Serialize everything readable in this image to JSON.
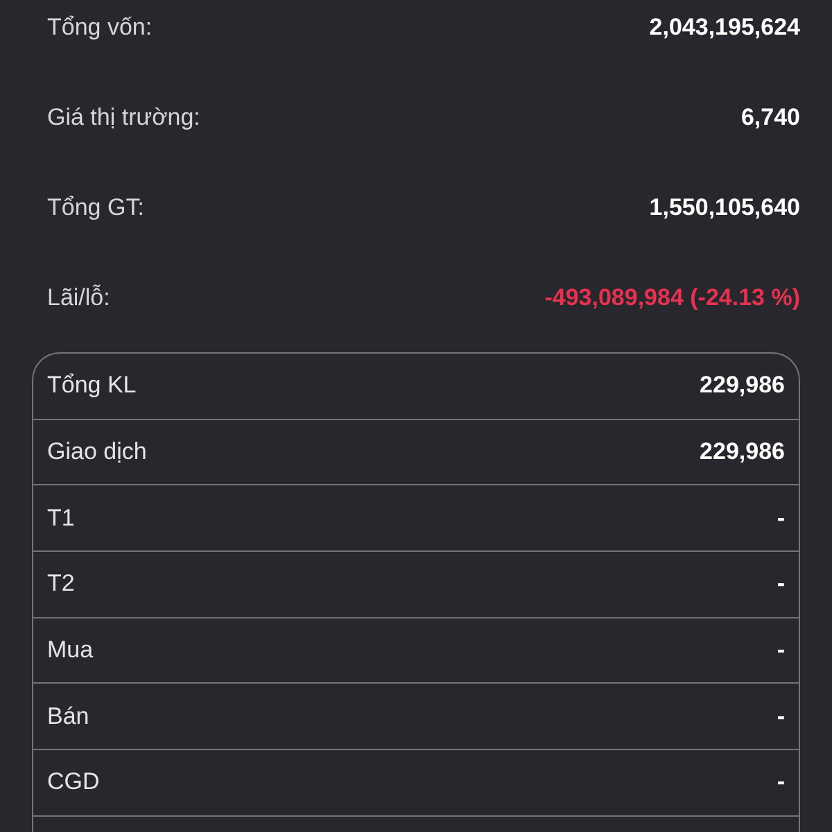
{
  "summary": [
    {
      "label": "Tổng vốn:",
      "value": "2,043,195,624",
      "negative": false
    },
    {
      "label": "Giá thị trường:",
      "value": "6,740",
      "negative": false
    },
    {
      "label": "Tổng GT:",
      "value": "1,550,105,640",
      "negative": false
    },
    {
      "label": "Lãi/lỗ:",
      "value": "-493,089,984 (-24.13 %)",
      "negative": true
    }
  ],
  "details": {
    "rows": [
      {
        "label": "Tổng KL",
        "value": "229,986"
      },
      {
        "label": "Giao dịch",
        "value": "229,986"
      },
      {
        "label": "T1",
        "value": "-"
      },
      {
        "label": "T2",
        "value": "-"
      },
      {
        "label": "Mua",
        "value": "-"
      },
      {
        "label": "Bán",
        "value": "-"
      },
      {
        "label": "CGD",
        "value": "-"
      }
    ]
  }
}
